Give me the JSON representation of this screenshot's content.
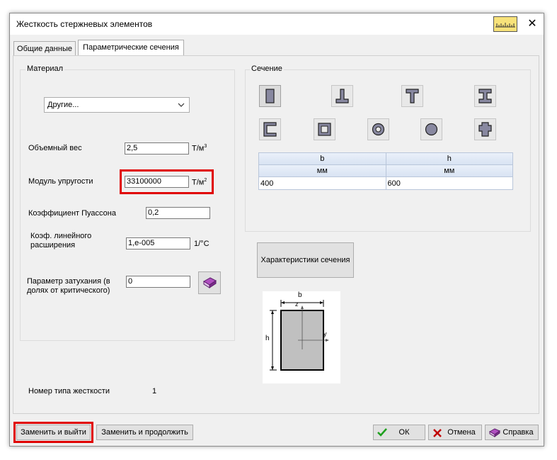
{
  "window": {
    "title": "Жесткость стержневых элементов"
  },
  "tabs": [
    {
      "label": "Общие данные",
      "active": false
    },
    {
      "label": "Параметрические сечения",
      "active": true
    }
  ],
  "material": {
    "group_label": "Материал",
    "selected": "Другие...",
    "volume_weight": {
      "label": "Объемный вес",
      "value": "2,5",
      "unit_base": "Т/м",
      "unit_exp": "3"
    },
    "modulus": {
      "label": "Модуль упругости",
      "value": "33100000",
      "unit_base": "Т/м",
      "unit_exp": "2"
    },
    "poisson": {
      "label": "Коэффициент Пуассона",
      "value": "0,2"
    },
    "thermal": {
      "label_line1": "Коэф. линейного",
      "label_line2": "расширения",
      "value": "1,e-005",
      "unit": "1/°C"
    },
    "damping": {
      "label_line1": "Параметр затухания (в",
      "label_line2": "долях от критического)",
      "value": "0"
    }
  },
  "section": {
    "group_label": "Сечение",
    "shapes": [
      "rectangle-icon",
      "t-section-icon",
      "inverted-t-section-icon",
      "i-beam-icon",
      "channel-icon",
      "box-section-icon",
      "ring-icon",
      "circle-icon",
      "cross-section-icon"
    ],
    "table": {
      "headers": [
        "b",
        "h"
      ],
      "units": [
        "мм",
        "мм"
      ],
      "values": [
        "400",
        "600"
      ]
    },
    "properties_button": "Характеристики сечения",
    "diagram": {
      "b": "b",
      "h": "h",
      "z": "z",
      "y": "y"
    }
  },
  "stiffness": {
    "label": "Номер типа жесткости",
    "value": "1"
  },
  "buttons": {
    "replace_exit": "Заменить и выйти",
    "replace_continue": "Заменить и продолжить",
    "ok": "ОК",
    "cancel": "Отмена",
    "help": "Справка"
  },
  "colors": {
    "highlight": "#e00000",
    "ok_green": "#1ea01e",
    "cancel_red": "#c00000"
  }
}
